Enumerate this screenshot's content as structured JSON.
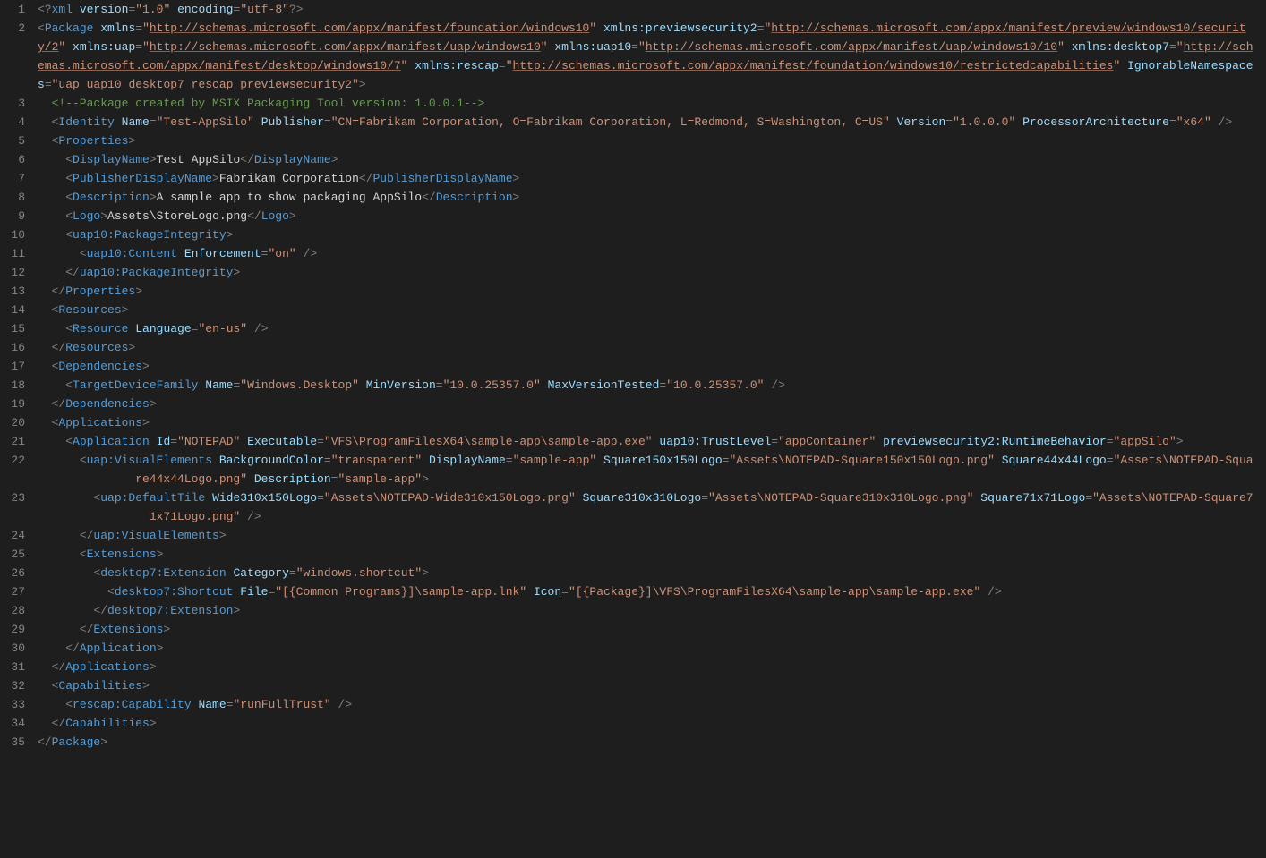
{
  "lineCount": 35,
  "xml": {
    "declaration": {
      "version": "1.0",
      "encoding": "utf-8"
    },
    "package": {
      "xmlns": "http://schemas.microsoft.com/appx/manifest/foundation/windows10",
      "xmlns_previewsecurity2": "http://schemas.microsoft.com/appx/manifest/preview/windows10/security/2",
      "xmlns_uap": "http://schemas.microsoft.com/appx/manifest/uap/windows10",
      "xmlns_uap10": "http://schemas.microsoft.com/appx/manifest/uap/windows10/10",
      "xmlns_desktop7": "http://schemas.microsoft.com/appx/manifest/desktop/windows10/7",
      "xmlns_rescap": "http://schemas.microsoft.com/appx/manifest/foundation/windows10/restrictedcapabilities",
      "IgnorableNamespaces": "uap uap10 desktop7 rescap previewsecurity2",
      "comment": "Package created by MSIX Packaging Tool version: 1.0.0.1",
      "Identity": {
        "Name": "Test-AppSilo",
        "Publisher": "CN=Fabrikam Corporation, O=Fabrikam Corporation, L=Redmond, S=Washington, C=US",
        "Version": "1.0.0.0",
        "ProcessorArchitecture": "x64"
      },
      "Properties": {
        "DisplayName": "Test AppSilo",
        "PublisherDisplayName": "Fabrikam Corporation",
        "Description": "A sample app to show packaging AppSilo",
        "Logo": "Assets\\StoreLogo.png",
        "uap10_PackageIntegrity": {
          "uap10_Content": {
            "Enforcement": "on"
          }
        }
      },
      "Resources": {
        "Resource": {
          "Language": "en-us"
        }
      },
      "Dependencies": {
        "TargetDeviceFamily": {
          "Name": "Windows.Desktop",
          "MinVersion": "10.0.25357.0",
          "MaxVersionTested": "10.0.25357.0"
        }
      },
      "Applications": {
        "Application": {
          "Id": "NOTEPAD",
          "Executable": "VFS\\ProgramFilesX64\\sample-app\\sample-app.exe",
          "uap10_TrustLevel": "appContainer",
          "previewsecurity2_RuntimeBehavior": "appSilo",
          "uap_VisualElements": {
            "BackgroundColor": "transparent",
            "DisplayName": "sample-app",
            "Square150x150Logo": "Assets\\NOTEPAD-Square150x150Logo.png",
            "Square44x44Logo": "Assets\\NOTEPAD-Square44x44Logo.png",
            "Description": "sample-app",
            "uap_DefaultTile": {
              "Wide310x150Logo": "Assets\\NOTEPAD-Wide310x150Logo.png",
              "Square310x310Logo": "Assets\\NOTEPAD-Square310x310Logo.png",
              "Square71x71Logo": "Assets\\NOTEPAD-Square71x71Logo.png"
            }
          },
          "Extensions": {
            "desktop7_Extension": {
              "Category": "windows.shortcut",
              "desktop7_Shortcut": {
                "File": "[{Common Programs}]\\sample-app.lnk",
                "Icon": "[{Package}]\\VFS\\ProgramFilesX64\\sample-app\\sample-app.exe"
              }
            }
          }
        }
      },
      "Capabilities": {
        "rescap_Capability": {
          "Name": "runFullTrust"
        }
      }
    }
  }
}
